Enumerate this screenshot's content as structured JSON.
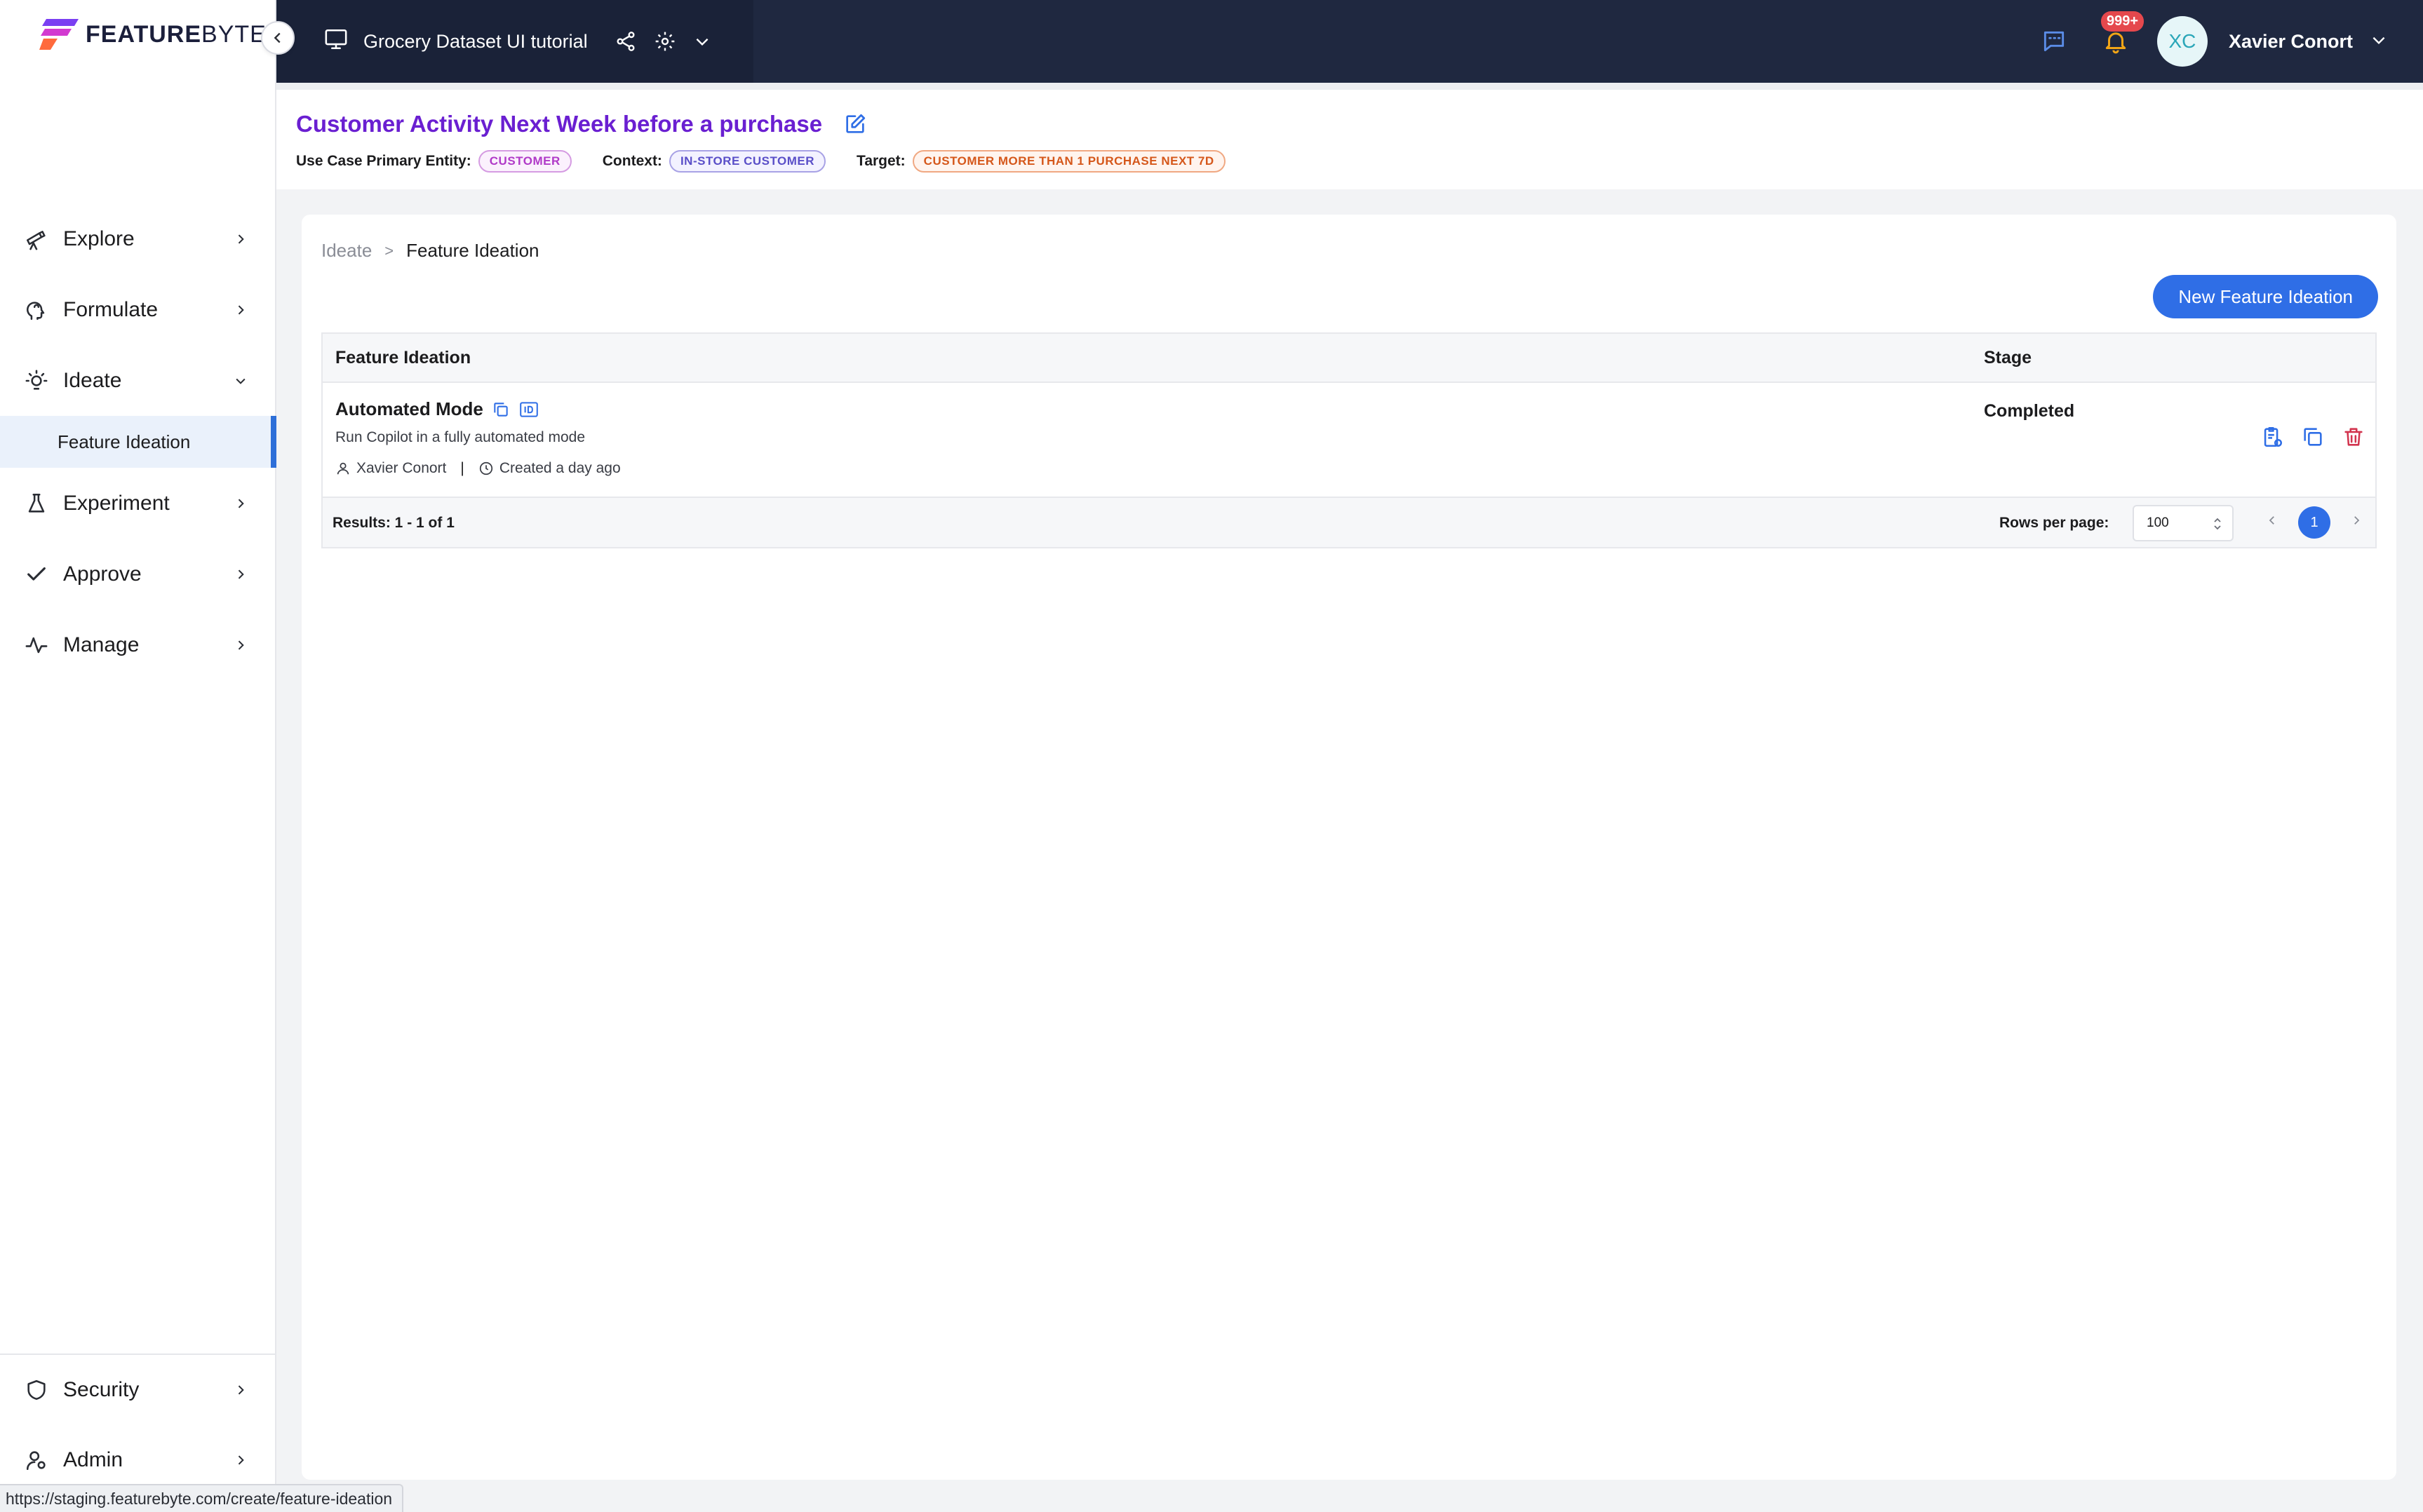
{
  "brand": {
    "name_bold": "FEATURE",
    "name_light": "BYTE"
  },
  "topbar": {
    "project_name": "Grocery Dataset UI tutorial",
    "notification_count": "999+",
    "user_initials": "XC",
    "user_name": "Xavier Conort"
  },
  "sidebar": {
    "items": [
      {
        "label": "Explore"
      },
      {
        "label": "Formulate"
      },
      {
        "label": "Ideate"
      },
      {
        "label": "Experiment"
      },
      {
        "label": "Approve"
      },
      {
        "label": "Manage"
      }
    ],
    "active_sub_item": "Feature Ideation",
    "bottom_items": [
      {
        "label": "Security"
      },
      {
        "label": "Admin"
      }
    ]
  },
  "use_case": {
    "title": "Customer Activity Next Week before a purchase",
    "entity_label": "Use Case Primary Entity:",
    "entity_value": "CUSTOMER",
    "context_label": "Context:",
    "context_value": "IN-STORE CUSTOMER",
    "target_label": "Target:",
    "target_value": "CUSTOMER MORE THAN 1 PURCHASE NEXT 7D"
  },
  "breadcrumb": {
    "parent": "Ideate",
    "separator": ">",
    "current": "Feature Ideation"
  },
  "new_button_label": "New Feature Ideation",
  "table": {
    "columns": [
      "Feature Ideation",
      "Stage"
    ],
    "rows": [
      {
        "name": "Automated Mode",
        "description": "Run Copilot in a fully automated mode",
        "author": "Xavier Conort",
        "created": "Created a day ago",
        "stage": "Completed"
      }
    ],
    "results_text": "Results: 1 - 1 of 1",
    "rows_per_page_label": "Rows per page:",
    "rows_per_page_value": "100",
    "current_page": "1"
  },
  "status_url": "https://staging.featurebyte.com/create/feature-ideation",
  "colors": {
    "topbar_bg": "#1f2840",
    "accent_blue": "#2f6ee6",
    "title_purple": "#6a1fd1",
    "delete_red": "#d2344e"
  }
}
